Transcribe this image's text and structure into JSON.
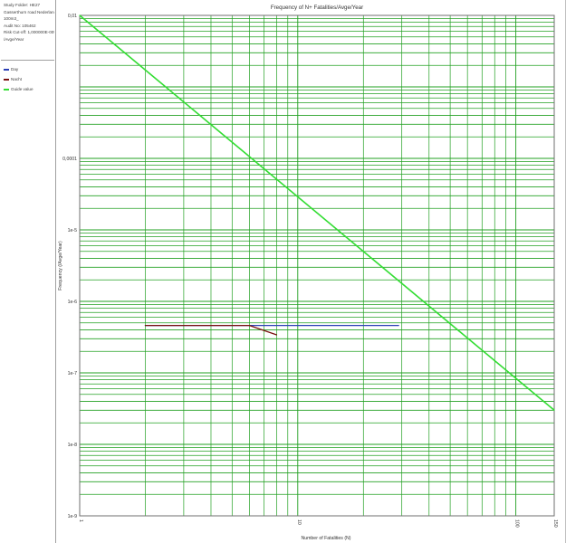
{
  "info": {
    "lines": [
      "Study Folder: HE27",
      "Gasserthurn road Nederland",
      "100m3_",
      "Audit No: 105462",
      "Risk Cut-off: 1,000000E-009",
      "/Avge/Year"
    ]
  },
  "colors": {
    "grid": "#22a022",
    "plot_border": "#6f6f6f",
    "day": "#2b3fb5",
    "night": "#7a1010",
    "guide": "#33dd33"
  },
  "chart_data": {
    "type": "line",
    "title": "Frequency of N+ Fatalities/Avge/Year",
    "xlabel": "Number of Fatalities (N)",
    "ylabel": "Frequency (/Avge/Year)",
    "xscale": "log",
    "yscale": "log",
    "xlim": [
      1,
      150
    ],
    "ylim": [
      1e-09,
      0.01
    ],
    "grid": true,
    "legend_position": "left panel",
    "x_ticks": [
      {
        "value": 1,
        "label": "1"
      },
      {
        "value": 10,
        "label": "10"
      },
      {
        "value": 100,
        "label": "100"
      },
      {
        "value": 150,
        "label": "150"
      }
    ],
    "y_ticks": [
      {
        "value": 0.01,
        "label": "0,01"
      },
      {
        "value": 0.0001,
        "label": "0,0001"
      },
      {
        "value": 1e-05,
        "label": "1e-5"
      },
      {
        "value": 1e-06,
        "label": "1e-6"
      },
      {
        "value": 1e-07,
        "label": "1e-7"
      },
      {
        "value": 1e-08,
        "label": "1e-8"
      },
      {
        "value": 1e-09,
        "label": "1e-9"
      }
    ],
    "series": [
      {
        "name": "Day",
        "color": "#2b3fb5",
        "x": [
          2,
          10,
          29
        ],
        "y": [
          4.6e-07,
          4.6e-07,
          4.6e-07
        ]
      },
      {
        "name": "Nacht",
        "color": "#7a1010",
        "x": [
          2,
          6,
          8
        ],
        "y": [
          4.6e-07,
          4.6e-07,
          3.4e-07
        ]
      },
      {
        "name": "Guide value",
        "color": "#33dd33",
        "x": [
          1,
          150
        ],
        "y": [
          0.01,
          3e-08
        ]
      }
    ]
  }
}
